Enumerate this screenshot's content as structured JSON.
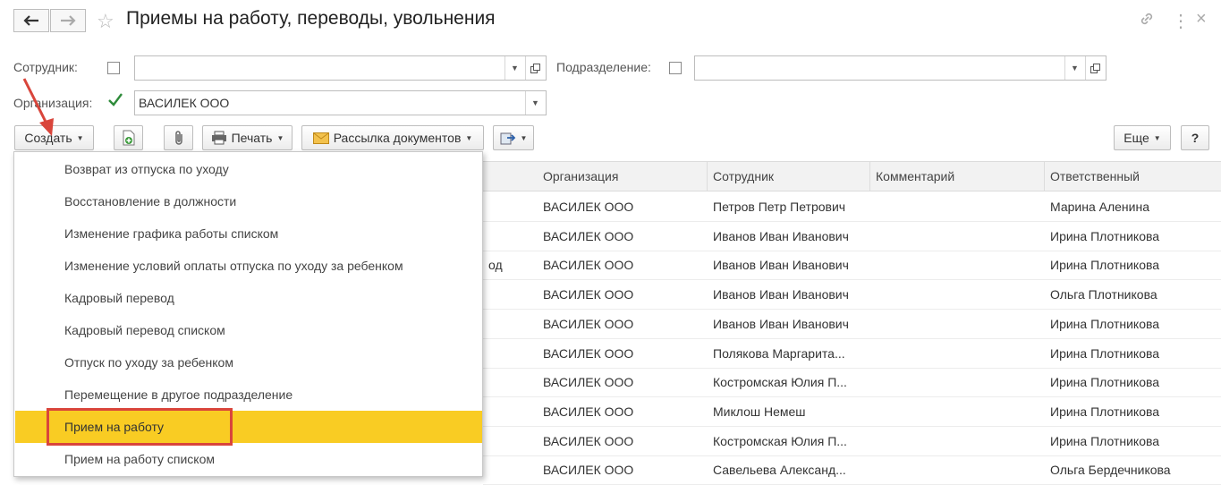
{
  "header": {
    "title": "Приемы на работу, переводы, увольнения"
  },
  "filters": {
    "employee_label": "Сотрудник:",
    "employee_value": "",
    "department_label": "Подразделение:",
    "department_value": "",
    "organization_label": "Организация:",
    "organization_value": "ВАСИЛЕК ООО"
  },
  "toolbar": {
    "create_label": "Создать",
    "print_label": "Печать",
    "mailing_label": "Рассылка документов",
    "more_label": "Еще",
    "help_label": "?"
  },
  "table": {
    "columns": [
      "Организация",
      "Сотрудник",
      "Комментарий",
      "Ответственный"
    ],
    "partial_fragment": "од",
    "rows": [
      {
        "org": "ВАСИЛЕК ООО",
        "employee": "Петров Петр Петрович",
        "comment": "",
        "responsible": "Марина Аленина"
      },
      {
        "org": "ВАСИЛЕК ООО",
        "employee": "Иванов Иван Иванович",
        "comment": "",
        "responsible": "Ирина Плотникова"
      },
      {
        "org": "ВАСИЛЕК ООО",
        "employee": "Иванов Иван Иванович",
        "comment": "",
        "responsible": "Ирина Плотникова"
      },
      {
        "org": "ВАСИЛЕК ООО",
        "employee": "Иванов Иван Иванович",
        "comment": "",
        "responsible": "Ольга Плотникова"
      },
      {
        "org": "ВАСИЛЕК ООО",
        "employee": "Иванов Иван Иванович",
        "comment": "",
        "responsible": "Ирина Плотникова"
      },
      {
        "org": "ВАСИЛЕК ООО",
        "employee": "Полякова Маргарита...",
        "comment": "",
        "responsible": "Ирина Плотникова"
      },
      {
        "org": "ВАСИЛЕК ООО",
        "employee": "Костромская Юлия П...",
        "comment": "",
        "responsible": "Ирина Плотникова"
      },
      {
        "org": "ВАСИЛЕК ООО",
        "employee": "Миклош Немеш",
        "comment": "",
        "responsible": "Ирина Плотникова"
      },
      {
        "org": "ВАСИЛЕК ООО",
        "employee": "Костромская Юлия П...",
        "comment": "",
        "responsible": "Ирина Плотникова"
      },
      {
        "org": "ВАСИЛЕК ООО",
        "employee": "Савельева Александ...",
        "comment": "",
        "responsible": "Ольга Бердечникова"
      }
    ]
  },
  "create_menu": {
    "items": [
      "Возврат из отпуска по уходу",
      "Восстановление в должности",
      "Изменение графика работы списком",
      "Изменение условий оплаты отпуска по уходу за ребенком",
      "Кадровый перевод",
      "Кадровый перевод списком",
      "Отпуск по уходу за ребенком",
      "Перемещение в другое подразделение",
      "Прием на работу",
      "Прием на работу списком"
    ],
    "selected_index": 8
  },
  "colors": {
    "selected": "#f9cc23",
    "annotation": "#d9453b",
    "checkmark": "#2e8b3a"
  },
  "icons": {
    "back": "arrow-left-icon",
    "forward": "arrow-right-icon",
    "favorite": "star-icon",
    "link": "link-icon",
    "menu": "more-vertical-icon",
    "close": "close-icon"
  }
}
